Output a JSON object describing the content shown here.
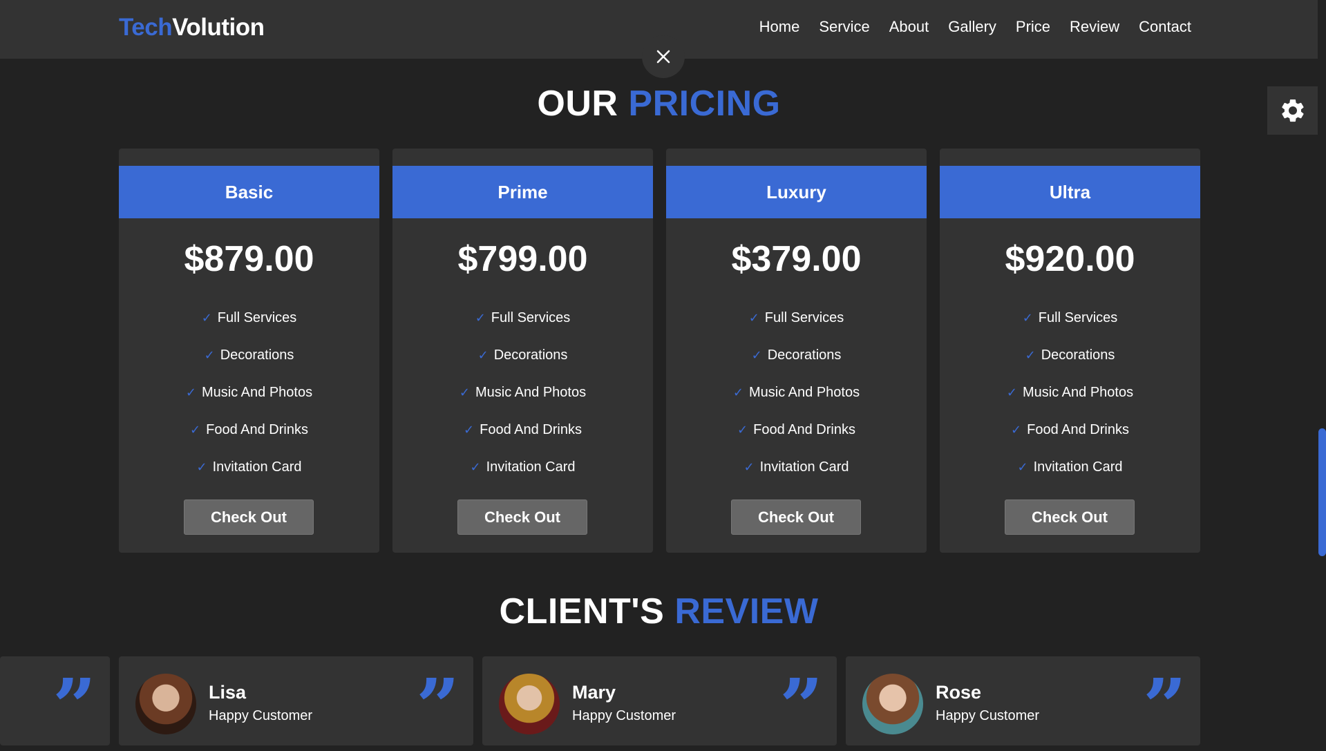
{
  "brand": {
    "part1": "Tech",
    "part2": "Volution",
    "accent_color": "#3a6ad4"
  },
  "nav": [
    "Home",
    "Service",
    "About",
    "Gallery",
    "Price",
    "Review",
    "Contact"
  ],
  "icons": {
    "close": "close-icon",
    "settings": "gear-icon",
    "quote": "quote-icon"
  },
  "pricing": {
    "title_part1": "OUR",
    "title_part2": "PRICING",
    "plans": [
      {
        "name": "Basic",
        "price": "$879.00",
        "features": [
          "Full Services",
          "Decorations",
          "Music And Photos",
          "Food And Drinks",
          "Invitation Card"
        ],
        "button": "Check Out"
      },
      {
        "name": "Prime",
        "price": "$799.00",
        "features": [
          "Full Services",
          "Decorations",
          "Music And Photos",
          "Food And Drinks",
          "Invitation Card"
        ],
        "button": "Check Out"
      },
      {
        "name": "Luxury",
        "price": "$379.00",
        "features": [
          "Full Services",
          "Decorations",
          "Music And Photos",
          "Food And Drinks",
          "Invitation Card"
        ],
        "button": "Check Out"
      },
      {
        "name": "Ultra",
        "price": "$920.00",
        "features": [
          "Full Services",
          "Decorations",
          "Music And Photos",
          "Food And Drinks",
          "Invitation Card"
        ],
        "button": "Check Out"
      }
    ]
  },
  "reviews": {
    "title_part1": "CLIENT'S",
    "title_part2": "REVIEW",
    "items": [
      {
        "name": "Lisa",
        "role": "Happy Customer"
      },
      {
        "name": "Mary",
        "role": "Happy Customer"
      },
      {
        "name": "Rose",
        "role": "Happy Customer"
      }
    ]
  }
}
